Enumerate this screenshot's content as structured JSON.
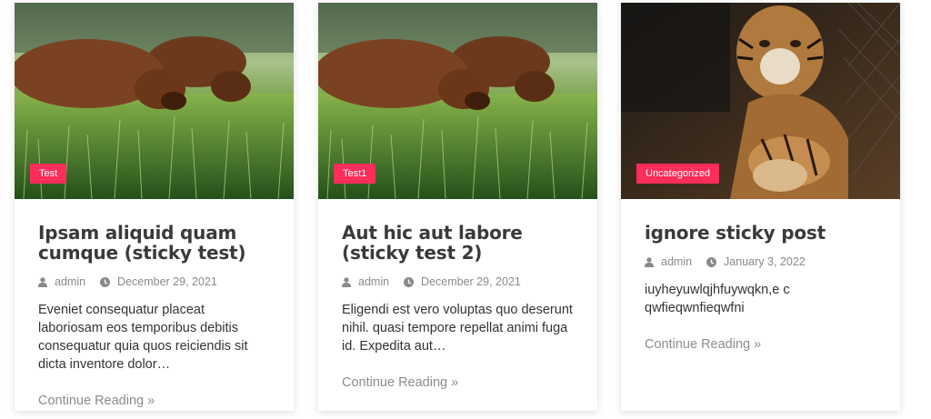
{
  "colors": {
    "accent": "#ff2d5a",
    "title": "#3a3a3a",
    "meta": "#8a8a8a",
    "link": "#8c8c8c"
  },
  "posts": [
    {
      "category": "Test",
      "title": "Ipsam aliquid quam cumque (sticky test)",
      "author": "admin",
      "date": "December 29, 2021",
      "excerpt": "Eveniet consequatur placeat laboriosam eos temporibus debitis consequatur quia quos reiciendis sit dicta inventore dolor…",
      "more": "Continue Reading »",
      "image": "dogs-grazing-grass"
    },
    {
      "category": "Test1",
      "title": "Aut hic aut labore (sticky test 2)",
      "author": "admin",
      "date": "December 29, 2021",
      "excerpt": "Eligendi est vero voluptas quo deserunt nihil. quasi tempore repellat animi fuga id. Expedita aut…",
      "more": "Continue Reading »",
      "image": "dogs-grazing-grass"
    },
    {
      "category": "Uncategorized",
      "title": "ignore sticky post",
      "author": "admin",
      "date": "January 3, 2022",
      "excerpt": "iuyheyuwlqjhfuywqkn,e c qwfieqwnfieqwfni",
      "more": "Continue Reading »",
      "image": "tiger-cub"
    }
  ],
  "icons": {
    "author": "user-icon",
    "date": "clock-icon"
  }
}
